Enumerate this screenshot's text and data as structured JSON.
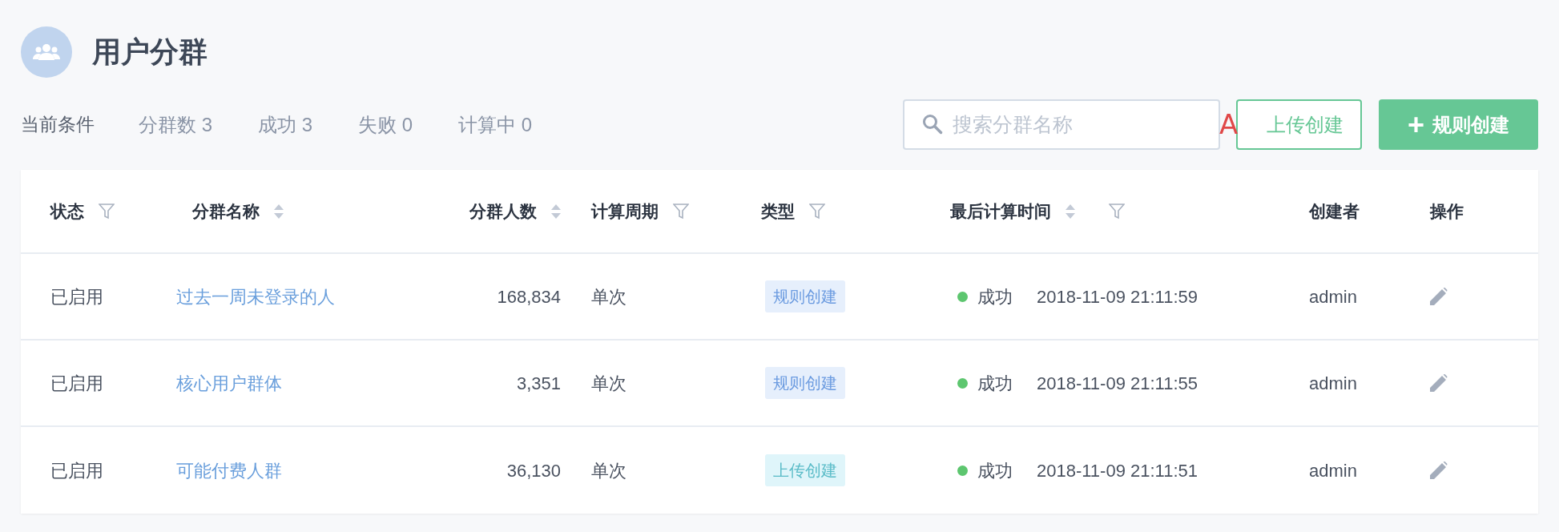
{
  "header": {
    "title": "用户分群"
  },
  "summary": {
    "label": "当前条件",
    "stats": [
      "分群数 3",
      "成功 3",
      "失败 0",
      "计算中 0"
    ]
  },
  "search": {
    "placeholder": "搜索分群名称"
  },
  "annotation": "A",
  "buttons": [
    {
      "kind": "outline",
      "label": "上传创建"
    },
    {
      "kind": "primary",
      "icon": "+",
      "label": "规则创建"
    }
  ],
  "table": {
    "columns": [
      {
        "label": "状态",
        "sortable": false,
        "filterable": true
      },
      {
        "label": "分群名称",
        "sortable": true,
        "filterable": false
      },
      {
        "label": "分群人数",
        "sortable": true,
        "filterable": false
      },
      {
        "label": "计算周期",
        "sortable": false,
        "filterable": true
      },
      {
        "label": "类型",
        "sortable": false,
        "filterable": true
      },
      {
        "label": "最后计算时间",
        "sortable": true,
        "filterable": true
      },
      {
        "label": "创建者",
        "sortable": false,
        "filterable": false
      },
      {
        "label": "操作",
        "sortable": false,
        "filterable": false
      }
    ],
    "rows": [
      {
        "status": "已启用",
        "name": "过去一周未登录的人",
        "count": "168,834",
        "cycle": "单次",
        "type": {
          "kind": "rule",
          "label": "规则创建"
        },
        "result": {
          "label": "成功",
          "color": "#5dc66f"
        },
        "time": "2018-11-09 21:11:59",
        "creator": "admin"
      },
      {
        "status": "已启用",
        "name": "核心用户群体",
        "count": "3,351",
        "cycle": "单次",
        "type": {
          "kind": "rule",
          "label": "规则创建"
        },
        "result": {
          "label": "成功",
          "color": "#5dc66f"
        },
        "time": "2018-11-09 21:11:55",
        "creator": "admin"
      },
      {
        "status": "已启用",
        "name": "可能付费人群",
        "count": "36,130",
        "cycle": "单次",
        "type": {
          "kind": "upload",
          "label": "上传创建"
        },
        "result": {
          "label": "成功",
          "color": "#5dc66f"
        },
        "time": "2018-11-09 21:11:51",
        "creator": "admin"
      }
    ]
  }
}
